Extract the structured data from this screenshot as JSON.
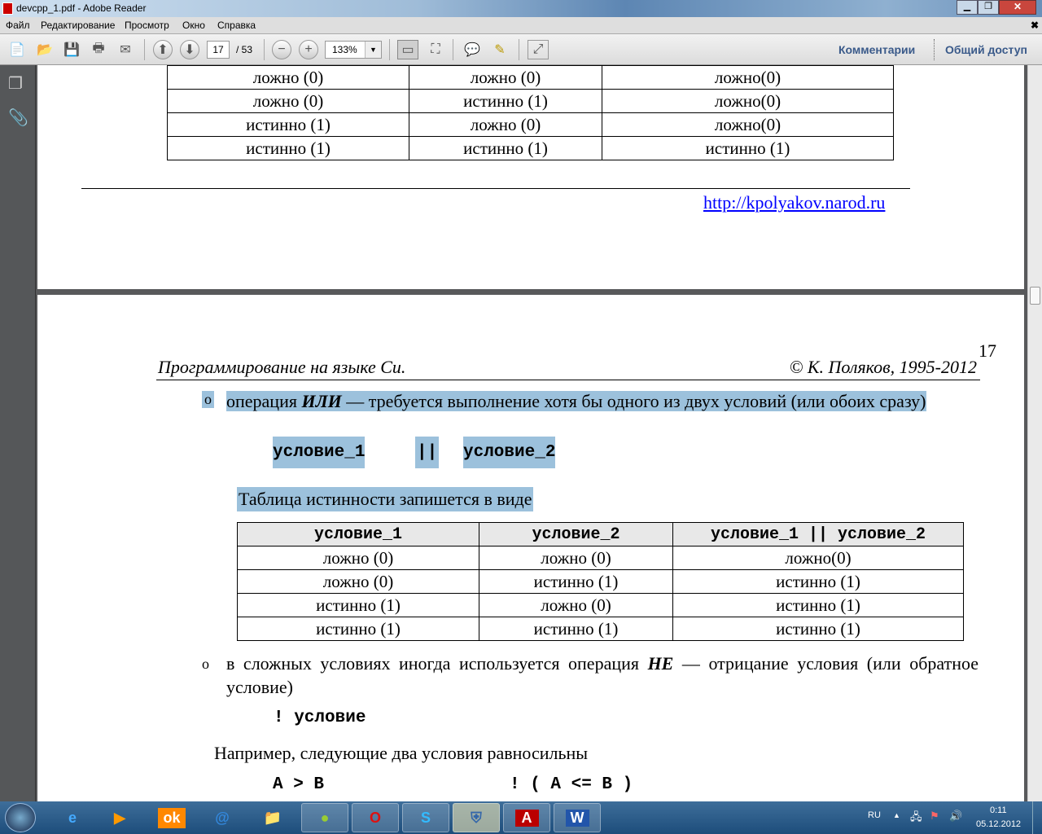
{
  "window": {
    "title": "devcpp_1.pdf - Adobe Reader"
  },
  "menu": [
    "Файл",
    "Редактирование",
    "Просмотр",
    "Окно",
    "Справка"
  ],
  "toolbar": {
    "page_current": "17",
    "page_total": "/ 53",
    "zoom": "133%",
    "comments": "Комментарии",
    "share": "Общий доступ"
  },
  "page_prev": {
    "rows": [
      [
        "ложно (0)",
        "ложно (0)",
        "ложно(0)"
      ],
      [
        "ложно (0)",
        "истинно (1)",
        "ложно(0)"
      ],
      [
        "истинно (1)",
        "ложно (0)",
        "ложно(0)"
      ],
      [
        "истинно (1)",
        "истинно (1)",
        "истинно (1)"
      ]
    ],
    "link": "http://kpolyakov.narod.ru"
  },
  "page": {
    "number": "17",
    "header_left": "Программирование на языке Си.",
    "header_right": "© К. Поляков, 1995-2012",
    "bullet": "o",
    "or_pre": "операция ",
    "or_bold": "ИЛИ",
    "or_post": " — требуется выполнение хотя бы одного из двух условий (или обоих сразу)",
    "code1": "условие_1",
    "code_op": "||",
    "code2": "условие_2",
    "table_intro": "Таблица истинности запишется в виде",
    "table_headers": [
      "условие_1",
      "условие_2",
      "условие_1 || условие_2"
    ],
    "table_rows": [
      [
        "ложно (0)",
        "ложно (0)",
        "ложно(0)"
      ],
      [
        "ложно (0)",
        "истинно (1)",
        "истинно (1)"
      ],
      [
        "истинно (1)",
        "ложно (0)",
        "истинно (1)"
      ],
      [
        "истинно (1)",
        "истинно (1)",
        "истинно (1)"
      ]
    ],
    "not_pre": "в сложных условиях иногда используется операция ",
    "not_bold": "НЕ",
    "not_post": " — отрицание условия (или обратное условие)",
    "not_code": "! условие",
    "example": "Например, следующие два условия равносильны",
    "ex_left": "A > B",
    "ex_right": "! ( A <= B )"
  },
  "taskbar": {
    "lang": "RU",
    "time": "0:11",
    "date": "05.12.2012"
  }
}
